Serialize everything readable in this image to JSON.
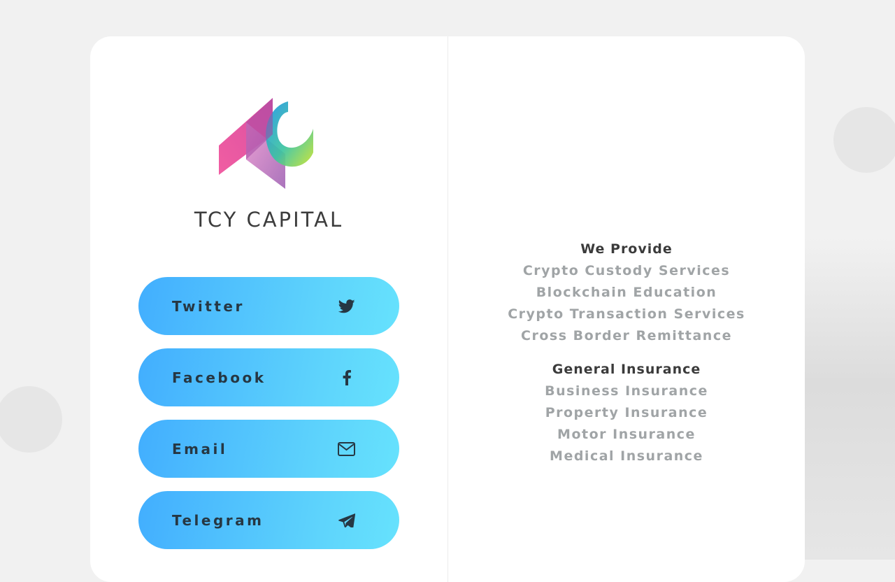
{
  "brand": {
    "name": "TCY CAPITAL"
  },
  "social_links": [
    {
      "label": "Twitter",
      "icon": "twitter-icon"
    },
    {
      "label": "Facebook",
      "icon": "facebook-icon"
    },
    {
      "label": "Email",
      "icon": "envelope-icon"
    },
    {
      "label": "Telegram",
      "icon": "paper-plane-icon"
    }
  ],
  "services": {
    "provide_heading": "We Provide",
    "provide_items": [
      "Crypto Custody Services",
      "Blockchain Education",
      "Crypto Transaction Services",
      "Cross Border Remittance"
    ],
    "insurance_heading": "General Insurance",
    "insurance_items": [
      "Business Insurance",
      "Property Insurance",
      "Motor Insurance",
      "Medical Insurance"
    ]
  },
  "colors": {
    "button_gradient_start": "#42aefe",
    "button_gradient_end": "#66e2fd",
    "heading_text": "#3b3b3b",
    "muted_text": "#a0a4a6",
    "page_background": "#f1f1f1"
  }
}
